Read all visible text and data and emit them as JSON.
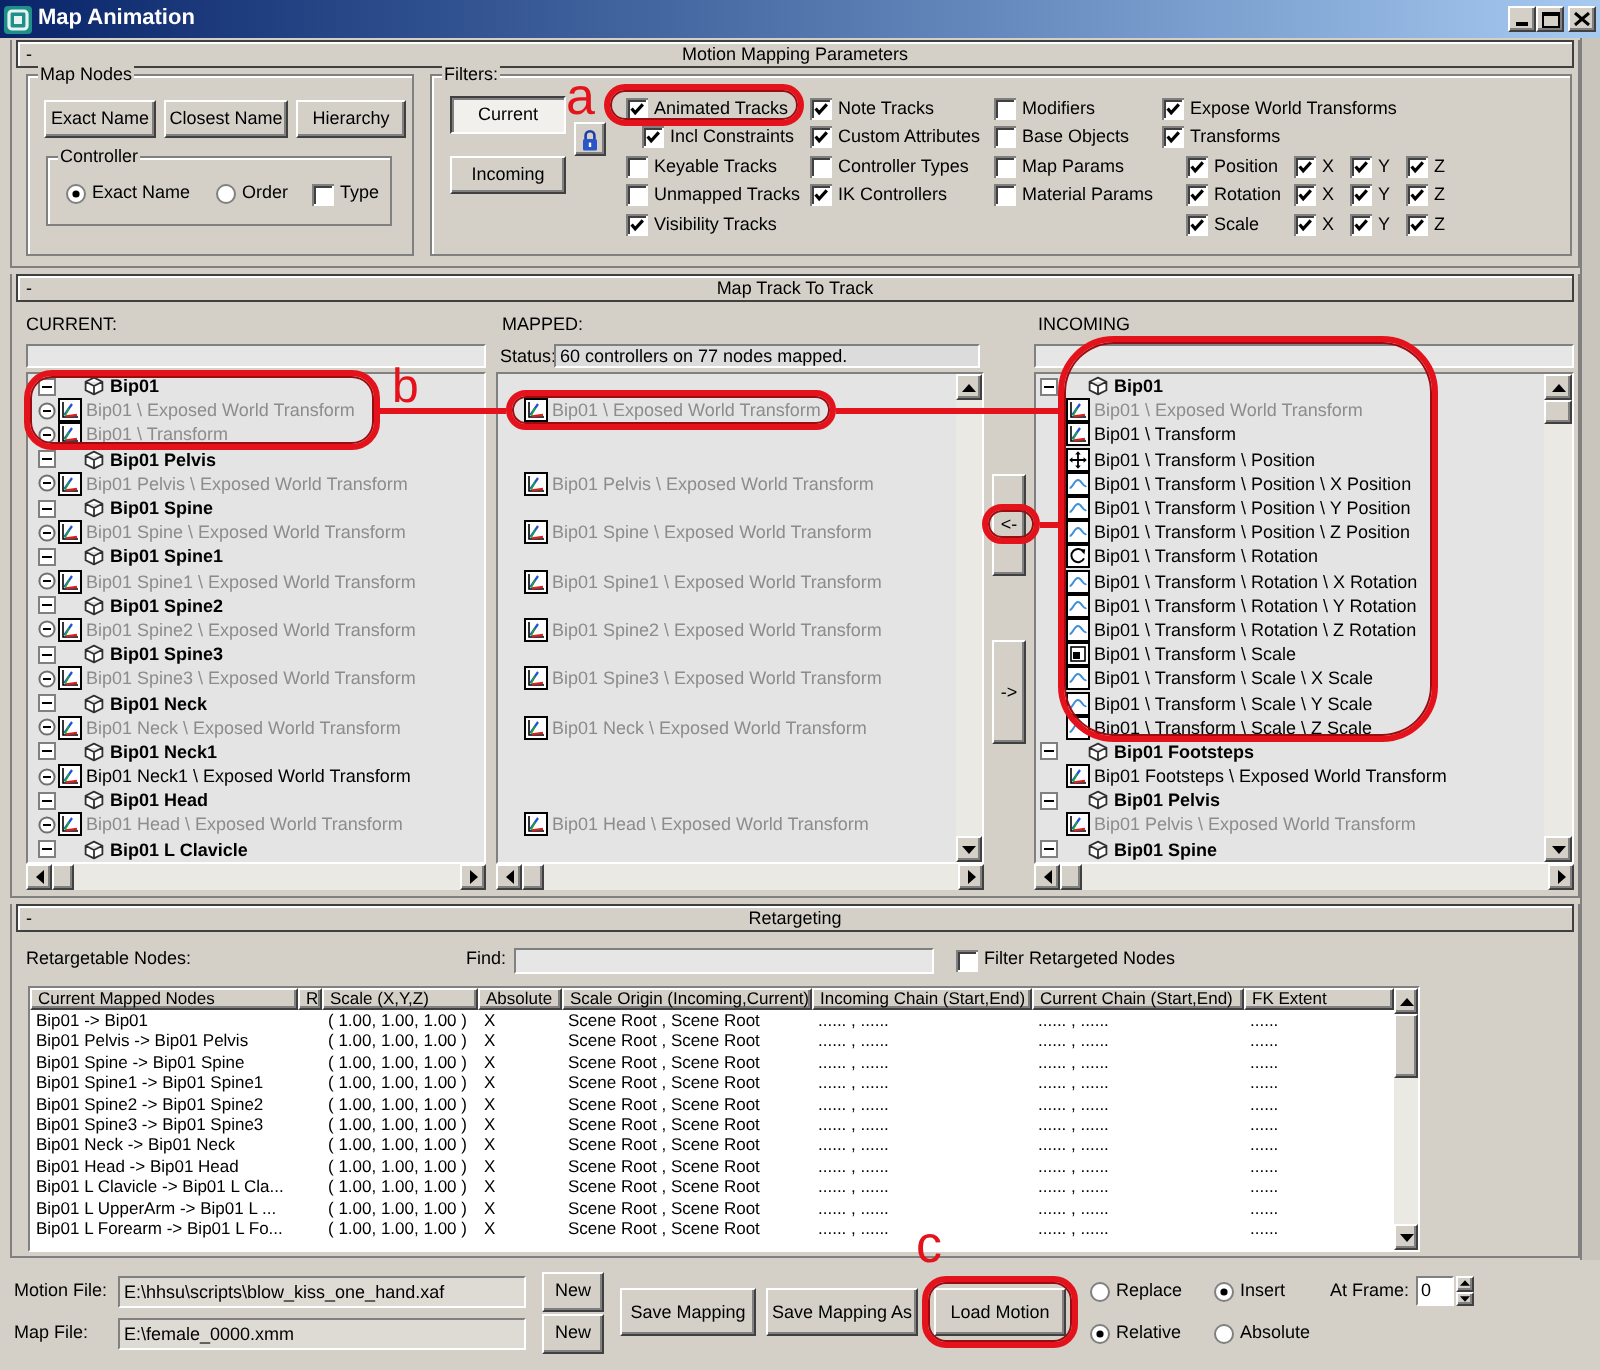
{
  "window": {
    "title": "Map Animation"
  },
  "motion_mapping": {
    "toggle": "-",
    "title": "Motion Mapping Parameters",
    "map_nodes": {
      "title": "Map Nodes",
      "buttons": [
        "Exact Name",
        "Closest Name",
        "Hierarchy"
      ],
      "controller": {
        "title": "Controller",
        "options": [
          {
            "kind": "radio",
            "label": "Exact Name",
            "selected": true
          },
          {
            "kind": "radio",
            "label": "Order",
            "selected": false
          },
          {
            "kind": "checkbox",
            "label": "Type",
            "checked": false
          }
        ]
      }
    },
    "filters": {
      "title": "Filters:",
      "sources": [
        {
          "label": "Current",
          "selected": true
        },
        {
          "label": "Incoming",
          "selected": false
        }
      ],
      "columns": [
        [
          {
            "label": "Animated Tracks",
            "checked": true,
            "children": [
              {
                "label": "Incl Constraints",
                "checked": true
              }
            ]
          },
          {
            "label": "Keyable Tracks",
            "checked": false
          },
          {
            "label": "Unmapped Tracks",
            "checked": false
          },
          {
            "label": "Visibility Tracks",
            "checked": true
          }
        ],
        [
          {
            "label": "Note Tracks",
            "checked": true
          },
          {
            "label": "Custom Attributes",
            "checked": true
          },
          {
            "label": "Controller Types",
            "checked": false
          },
          {
            "label": "IK Controllers",
            "checked": true
          }
        ],
        [
          {
            "label": "Modifiers",
            "checked": false
          },
          {
            "label": "Base Objects",
            "checked": false
          },
          {
            "label": "Map Params",
            "checked": false
          },
          {
            "label": "Material Params",
            "checked": false
          }
        ],
        [
          {
            "label": "Expose World Transforms",
            "checked": true
          },
          {
            "label": "Transforms",
            "checked": true,
            "children": [
              {
                "label": "Position",
                "checked": true,
                "axes": [
                  {
                    "label": "X",
                    "checked": true
                  },
                  {
                    "label": "Y",
                    "checked": true
                  },
                  {
                    "label": "Z",
                    "checked": true
                  }
                ]
              },
              {
                "label": "Rotation",
                "checked": true,
                "axes": [
                  {
                    "label": "X",
                    "checked": true
                  },
                  {
                    "label": "Y",
                    "checked": true
                  },
                  {
                    "label": "Z",
                    "checked": true
                  }
                ]
              },
              {
                "label": "Scale",
                "checked": true,
                "axes": [
                  {
                    "label": "X",
                    "checked": true
                  },
                  {
                    "label": "Y",
                    "checked": true
                  },
                  {
                    "label": "Z",
                    "checked": true
                  }
                ]
              }
            ]
          }
        ]
      ]
    }
  },
  "map_track_to_track": {
    "toggle": "-",
    "title": "Map Track To Track",
    "current": {
      "label": "CURRENT:",
      "nodes": [
        {
          "label": "Bip01",
          "expanded": true,
          "children": [
            {
              "label": "Bip01 \\ Exposed World Transform",
              "kind": "xform",
              "dimmed": true
            },
            {
              "label": "Bip01 \\ Transform",
              "kind": "xform",
              "dimmed": true
            }
          ]
        },
        {
          "label": "Bip01 Pelvis",
          "expanded": true,
          "children": [
            {
              "label": "Bip01 Pelvis \\ Exposed World Transform",
              "kind": "xform",
              "dimmed": true
            }
          ]
        },
        {
          "label": "Bip01 Spine",
          "expanded": true,
          "children": [
            {
              "label": "Bip01 Spine \\ Exposed World Transform",
              "kind": "xform",
              "dimmed": true
            }
          ]
        },
        {
          "label": "Bip01 Spine1",
          "expanded": true,
          "children": [
            {
              "label": "Bip01 Spine1 \\ Exposed World Transform",
              "kind": "xform",
              "dimmed": true
            }
          ]
        },
        {
          "label": "Bip01 Spine2",
          "expanded": true,
          "children": [
            {
              "label": "Bip01 Spine2 \\ Exposed World Transform",
              "kind": "xform",
              "dimmed": true
            }
          ]
        },
        {
          "label": "Bip01 Spine3",
          "expanded": true,
          "children": [
            {
              "label": "Bip01 Spine3 \\ Exposed World Transform",
              "kind": "xform",
              "dimmed": true
            }
          ]
        },
        {
          "label": "Bip01 Neck",
          "expanded": true,
          "children": [
            {
              "label": "Bip01 Neck \\ Exposed World Transform",
              "kind": "xform",
              "dimmed": true
            }
          ]
        },
        {
          "label": "Bip01 Neck1",
          "expanded": true,
          "children": [
            {
              "label": "Bip01 Neck1 \\ Exposed World Transform",
              "kind": "xform",
              "dimmed": false
            }
          ]
        },
        {
          "label": "Bip01 Head",
          "expanded": true,
          "children": [
            {
              "label": "Bip01 Head \\ Exposed World Transform",
              "kind": "xform",
              "dimmed": true
            }
          ]
        },
        {
          "label": "Bip01 L Clavicle",
          "expanded": true
        }
      ]
    },
    "mapped": {
      "label": "MAPPED:",
      "status_label": "Status:",
      "status": "60 controllers on 77 nodes mapped.",
      "rows": [
        {
          "kind": "blank"
        },
        {
          "kind": "track",
          "label": "Bip01 \\ Exposed World Transform",
          "dimmed": true
        },
        {
          "kind": "blank"
        },
        {
          "kind": "blank"
        },
        {
          "kind": "track",
          "label": "Bip01 Pelvis \\ Exposed World Transform",
          "dimmed": true
        },
        {
          "kind": "blank"
        },
        {
          "kind": "track",
          "label": "Bip01 Spine \\ Exposed World Transform",
          "dimmed": true
        },
        {
          "kind": "blank"
        },
        {
          "kind": "track",
          "label": "Bip01 Spine1 \\ Exposed World Transform",
          "dimmed": true
        },
        {
          "kind": "blank"
        },
        {
          "kind": "track",
          "label": "Bip01 Spine2 \\ Exposed World Transform",
          "dimmed": true
        },
        {
          "kind": "blank"
        },
        {
          "kind": "track",
          "label": "Bip01 Spine3 \\ Exposed World Transform",
          "dimmed": true
        },
        {
          "kind": "blank"
        },
        {
          "kind": "track",
          "label": "Bip01 Neck \\ Exposed World Transform",
          "dimmed": true
        },
        {
          "kind": "blank"
        },
        {
          "kind": "blank"
        },
        {
          "kind": "blank"
        },
        {
          "kind": "track",
          "label": "Bip01 Head \\ Exposed World Transform",
          "dimmed": true
        }
      ]
    },
    "arrows": [
      "<-",
      "->"
    ],
    "incoming": {
      "label": "INCOMING",
      "nodes": [
        {
          "label": "Bip01",
          "expanded": true,
          "children": [
            {
              "label": "Bip01 \\ Exposed World Transform",
              "kind": "xform",
              "dimmed": true
            },
            {
              "label": "Bip01 \\ Transform",
              "kind": "xform",
              "dimmed": false
            },
            {
              "label": "Bip01 \\ Transform \\ Position",
              "kind": "position",
              "dimmed": false
            },
            {
              "label": "Bip01 \\ Transform \\ Position \\ X Position",
              "kind": "float",
              "dimmed": false
            },
            {
              "label": "Bip01 \\ Transform \\ Position \\ Y Position",
              "kind": "float",
              "dimmed": false
            },
            {
              "label": "Bip01 \\ Transform \\ Position \\ Z Position",
              "kind": "float",
              "dimmed": false
            },
            {
              "label": "Bip01 \\ Transform \\ Rotation",
              "kind": "rotation",
              "dimmed": false
            },
            {
              "label": "Bip01 \\ Transform \\ Rotation \\ X Rotation",
              "kind": "float",
              "dimmed": false
            },
            {
              "label": "Bip01 \\ Transform \\ Rotation \\ Y Rotation",
              "kind": "float",
              "dimmed": false
            },
            {
              "label": "Bip01 \\ Transform \\ Rotation \\ Z Rotation",
              "kind": "float",
              "dimmed": false
            },
            {
              "label": "Bip01 \\ Transform \\ Scale",
              "kind": "scale",
              "dimmed": false
            },
            {
              "label": "Bip01 \\ Transform \\ Scale \\ X Scale",
              "kind": "float",
              "dimmed": false
            },
            {
              "label": "Bip01 \\ Transform \\ Scale \\ Y Scale",
              "kind": "float",
              "dimmed": false
            },
            {
              "label": "Bip01 \\ Transform \\ Scale \\ Z Scale",
              "kind": "float",
              "dimmed": false
            }
          ]
        },
        {
          "label": "Bip01 Footsteps",
          "expanded": true,
          "children": [
            {
              "label": "Bip01 Footsteps \\ Exposed World Transform",
              "kind": "xform",
              "dimmed": false
            }
          ]
        },
        {
          "label": "Bip01 Pelvis",
          "expanded": true,
          "children": [
            {
              "label": "Bip01 Pelvis \\ Exposed World Transform",
              "kind": "xform",
              "dimmed": true
            }
          ]
        },
        {
          "label": "Bip01 Spine",
          "expanded": true
        }
      ]
    }
  },
  "retargeting": {
    "toggle": "-",
    "title": "Retargeting",
    "nodes_label": "Retargetable Nodes:",
    "find_label": "Find:",
    "filter": {
      "label": "Filter Retargeted Nodes",
      "checked": false
    },
    "table": {
      "columns": [
        "Current Mapped Nodes",
        "R",
        "Scale (X,Y,Z)",
        "Absolute",
        "Scale Origin (Incoming,Current)",
        "Incoming Chain (Start,End)",
        "Current Chain (Start,End)",
        "FK Extent"
      ],
      "rows": [
        {
          "mapping": "Bip01 -> Bip01",
          "scale": "( 1.00, 1.00, 1.00 )",
          "absolute": "X",
          "scale_origin": "Scene Root , Scene Root",
          "incoming_chain": "...... , ......",
          "current_chain": "...... , ......",
          "fk_extent": "......"
        },
        {
          "mapping": "Bip01 Pelvis -> Bip01 Pelvis",
          "scale": "( 1.00, 1.00, 1.00 )",
          "absolute": "X",
          "scale_origin": "Scene Root , Scene Root",
          "incoming_chain": "...... , ......",
          "current_chain": "...... , ......",
          "fk_extent": "......"
        },
        {
          "mapping": "Bip01 Spine -> Bip01 Spine",
          "scale": "( 1.00, 1.00, 1.00 )",
          "absolute": "X",
          "scale_origin": "Scene Root , Scene Root",
          "incoming_chain": "...... , ......",
          "current_chain": "...... , ......",
          "fk_extent": "......"
        },
        {
          "mapping": "Bip01 Spine1 -> Bip01 Spine1",
          "scale": "( 1.00, 1.00, 1.00 )",
          "absolute": "X",
          "scale_origin": "Scene Root , Scene Root",
          "incoming_chain": "...... , ......",
          "current_chain": "...... , ......",
          "fk_extent": "......"
        },
        {
          "mapping": "Bip01 Spine2 -> Bip01 Spine2",
          "scale": "( 1.00, 1.00, 1.00 )",
          "absolute": "X",
          "scale_origin": "Scene Root , Scene Root",
          "incoming_chain": "...... , ......",
          "current_chain": "...... , ......",
          "fk_extent": "......"
        },
        {
          "mapping": "Bip01 Spine3 -> Bip01 Spine3",
          "scale": "( 1.00, 1.00, 1.00 )",
          "absolute": "X",
          "scale_origin": "Scene Root , Scene Root",
          "incoming_chain": "...... , ......",
          "current_chain": "...... , ......",
          "fk_extent": "......"
        },
        {
          "mapping": "Bip01 Neck -> Bip01 Neck",
          "scale": "( 1.00, 1.00, 1.00 )",
          "absolute": "X",
          "scale_origin": "Scene Root , Scene Root",
          "incoming_chain": "...... , ......",
          "current_chain": "...... , ......",
          "fk_extent": "......"
        },
        {
          "mapping": "Bip01 Head -> Bip01 Head",
          "scale": "( 1.00, 1.00, 1.00 )",
          "absolute": "X",
          "scale_origin": "Scene Root , Scene Root",
          "incoming_chain": "...... , ......",
          "current_chain": "...... , ......",
          "fk_extent": "......"
        },
        {
          "mapping": "Bip01 L Clavicle -> Bip01 L Cla...",
          "scale": "( 1.00, 1.00, 1.00 )",
          "absolute": "X",
          "scale_origin": "Scene Root , Scene Root",
          "incoming_chain": "...... , ......",
          "current_chain": "...... , ......",
          "fk_extent": "......"
        },
        {
          "mapping": "Bip01 L UpperArm -> Bip01 L ...",
          "scale": "( 1.00, 1.00, 1.00 )",
          "absolute": "X",
          "scale_origin": "Scene Root , Scene Root",
          "incoming_chain": "...... , ......",
          "current_chain": "...... , ......",
          "fk_extent": "......"
        },
        {
          "mapping": "Bip01 L Forearm -> Bip01 L Fo...",
          "scale": "( 1.00, 1.00, 1.00 )",
          "absolute": "X",
          "scale_origin": "Scene Root , Scene Root",
          "incoming_chain": "...... , ......",
          "current_chain": "...... , ......",
          "fk_extent": "......"
        }
      ]
    }
  },
  "files": [
    {
      "label": "Motion File:",
      "value": "E:\\hhsu\\scripts\\blow_kiss_one_hand.xaf",
      "button": "New"
    },
    {
      "label": "Map File:",
      "value": "E:\\female_0000.xmm",
      "button": "New"
    }
  ],
  "actions": [
    "Save Mapping",
    "Save Mapping As",
    "Load Motion"
  ],
  "load_options": [
    [
      {
        "label": "Replace",
        "selected": false
      },
      {
        "label": "Insert",
        "selected": true
      }
    ],
    [
      {
        "label": "Relative",
        "selected": true
      },
      {
        "label": "Absolute",
        "selected": false
      }
    ]
  ],
  "at_frame": {
    "label": "At Frame:",
    "value": "0"
  },
  "annotations": [
    {
      "letter": "a"
    },
    {
      "letter": "b"
    },
    {
      "letter": "c"
    }
  ]
}
